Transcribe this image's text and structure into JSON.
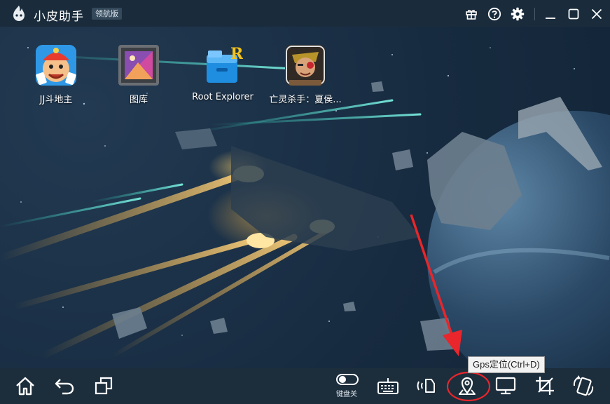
{
  "window": {
    "title": "小皮助手",
    "edition": "领航版"
  },
  "desktop": {
    "apps": [
      {
        "label": "JJ斗地主",
        "icon": "jj-doudizhu-icon"
      },
      {
        "label": "图库",
        "icon": "gallery-icon"
      },
      {
        "label": "Root Explorer",
        "icon": "root-explorer-icon"
      },
      {
        "label": "亡灵杀手：夏侯...",
        "icon": "undead-slayer-icon"
      }
    ]
  },
  "bottombar": {
    "keyboard_toggle_label": "键盘关"
  },
  "tooltip": {
    "text": "Gps定位(Ctrl+D)"
  },
  "colors": {
    "titlebar": "#1a2c3c",
    "bottombar": "#1c2d3c",
    "annotation_red": "#e8262b"
  }
}
